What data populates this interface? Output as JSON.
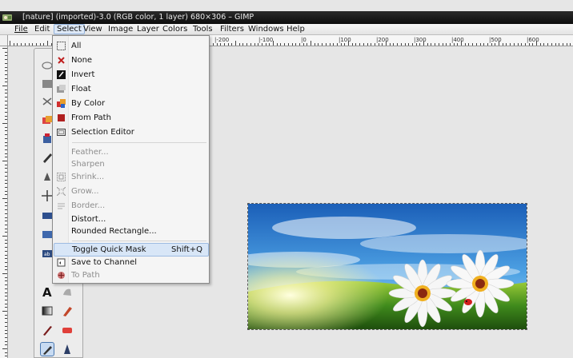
{
  "window": {
    "title": "[nature] (imported)-3.0 (RGB color, 1 layer) 680×306 – GIMP"
  },
  "menubar": {
    "items": [
      "File",
      "Edit",
      "Select",
      "View",
      "Image",
      "Layer",
      "Colors",
      "Tools",
      "Filters",
      "Windows",
      "Help"
    ],
    "active": "Select"
  },
  "ruler": {
    "top_labels": [
      "|-200",
      "|-100",
      "|0",
      "|100",
      "|200",
      "|300",
      "|400",
      "|500",
      "|600"
    ]
  },
  "select_menu": {
    "items": [
      {
        "label": "All",
        "icon": "select-all-icon",
        "enabled": true
      },
      {
        "label": "None",
        "icon": "select-none-icon",
        "enabled": true
      },
      {
        "label": "Invert",
        "icon": "invert-icon",
        "enabled": true
      },
      {
        "label": "Float",
        "icon": "float-icon",
        "enabled": true
      },
      {
        "label": "By Color",
        "icon": "by-color-icon",
        "enabled": true
      },
      {
        "label": "From Path",
        "icon": "from-path-icon",
        "enabled": true
      },
      {
        "label": "Selection Editor",
        "icon": "selection-editor-icon",
        "enabled": true
      },
      {
        "label": "Feather...",
        "icon": "",
        "enabled": false
      },
      {
        "label": "Sharpen",
        "icon": "",
        "enabled": false
      },
      {
        "label": "Shrink...",
        "icon": "shrink-icon",
        "enabled": false
      },
      {
        "label": "Grow...",
        "icon": "grow-icon",
        "enabled": false
      },
      {
        "label": "Border...",
        "icon": "border-icon",
        "enabled": false
      },
      {
        "label": "Distort...",
        "icon": "",
        "enabled": true
      },
      {
        "label": "Rounded Rectangle...",
        "icon": "",
        "enabled": true
      },
      {
        "label": "Toggle Quick Mask",
        "shortcut": "Shift+Q",
        "icon": "",
        "enabled": true,
        "highlighted": true
      },
      {
        "label": "Save to Channel",
        "icon": "save-to-channel-icon",
        "enabled": true
      },
      {
        "label": "To Path",
        "icon": "to-path-icon",
        "enabled": false
      }
    ]
  },
  "colors": {
    "menu_highlight": "#d8e6f7",
    "titlebar": "#111111",
    "canvas_bg": "#e6e6e6"
  }
}
